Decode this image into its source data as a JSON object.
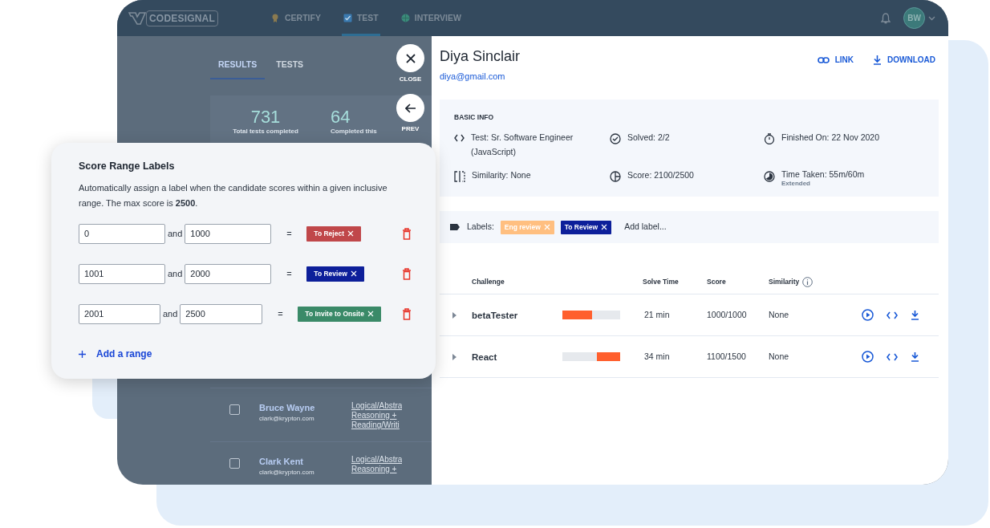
{
  "nav": {
    "logo": "CODESIGNAL",
    "items": [
      {
        "kind": "certify",
        "label": "CERTIFY",
        "selected": false
      },
      {
        "kind": "test",
        "label": "TEST",
        "selected": true
      },
      {
        "kind": "interview",
        "label": "INTERVIEW",
        "selected": false
      }
    ],
    "avatar": "BW"
  },
  "background_page": {
    "tabs": [
      {
        "label": "RESULTS",
        "selected": true
      },
      {
        "label": "TESTS",
        "selected": false
      }
    ],
    "stats": [
      {
        "value": "731",
        "label": "Total tests completed"
      },
      {
        "value": "64",
        "label": "Completed this"
      }
    ],
    "rows": [
      {
        "name": "Bruce Wayne",
        "email": "clark@krypton.com",
        "checked": false,
        "test_lines": [
          "Logical/Abstra",
          "Reasoning +",
          "Reading/Writi"
        ]
      },
      {
        "name": "Clark Kent",
        "email": "clark@krypton.com",
        "checked": false,
        "test_lines": [
          "Logical/Abstra",
          "Reasoning +"
        ]
      }
    ]
  },
  "drawer_controls": [
    {
      "kind": "close",
      "label": "CLOSE"
    },
    {
      "kind": "prev",
      "label": "PREV"
    }
  ],
  "candidate": {
    "name": "Diya Sinclair",
    "email": "diya@gmail.com",
    "actions": [
      {
        "kind": "link",
        "label": "LINK"
      },
      {
        "kind": "download",
        "label": "DOWNLOAD"
      }
    ]
  },
  "basic_info": {
    "title": "BASIC INFO",
    "items": [
      {
        "kind": "code",
        "text": "Test: Sr. Software Engineer (JavaScript)"
      },
      {
        "kind": "check",
        "text": "Solved: 2/2"
      },
      {
        "kind": "timer",
        "text": "Finished On: 22 Nov 2020"
      },
      {
        "kind": "similarity",
        "text": "Similarity: None"
      },
      {
        "kind": "score",
        "text": "Score: 2100/2500"
      },
      {
        "kind": "time",
        "text": "Time Taken: 55m/60m",
        "note": "Extended"
      }
    ]
  },
  "labels": {
    "caption": "Labels:",
    "tags": [
      {
        "text": "Eng review",
        "color": "#ffbf80"
      },
      {
        "text": "To Review",
        "color": "#0d1f9a"
      }
    ],
    "add": "Add label..."
  },
  "challenges": {
    "columns": [
      "Challenge",
      "Solve Time",
      "Score",
      "Similarity"
    ],
    "rows": [
      {
        "name": "betaTester",
        "level": 0.52,
        "kind": "start",
        "solve_time": "21 min",
        "score": "1000/1000",
        "similarity": "None"
      },
      {
        "name": "React",
        "level": 0.4,
        "kind": "end",
        "solve_time": "34 min",
        "score": "1100/1500",
        "similarity": "None"
      }
    ]
  },
  "score_range_popup": {
    "title": "Score Range Labels",
    "description": "Automatically assign a label when the candidate scores within a given inclusive range. The max score is **2500**.",
    "ranges": [
      {
        "from": "0",
        "joiner": "and",
        "to": "1000",
        "equals": "=",
        "label": "To Reject",
        "color": "#c0474a"
      },
      {
        "from": "1001",
        "joiner": "and",
        "to": "2000",
        "equals": "=",
        "label": "To Review",
        "color": "#0d1f9a"
      },
      {
        "from": "2001",
        "joiner": "and",
        "to": "2500",
        "equals": "=",
        "label": "To Invite to Onsite",
        "color": "#3a8a68"
      }
    ],
    "add": "Add a range"
  }
}
